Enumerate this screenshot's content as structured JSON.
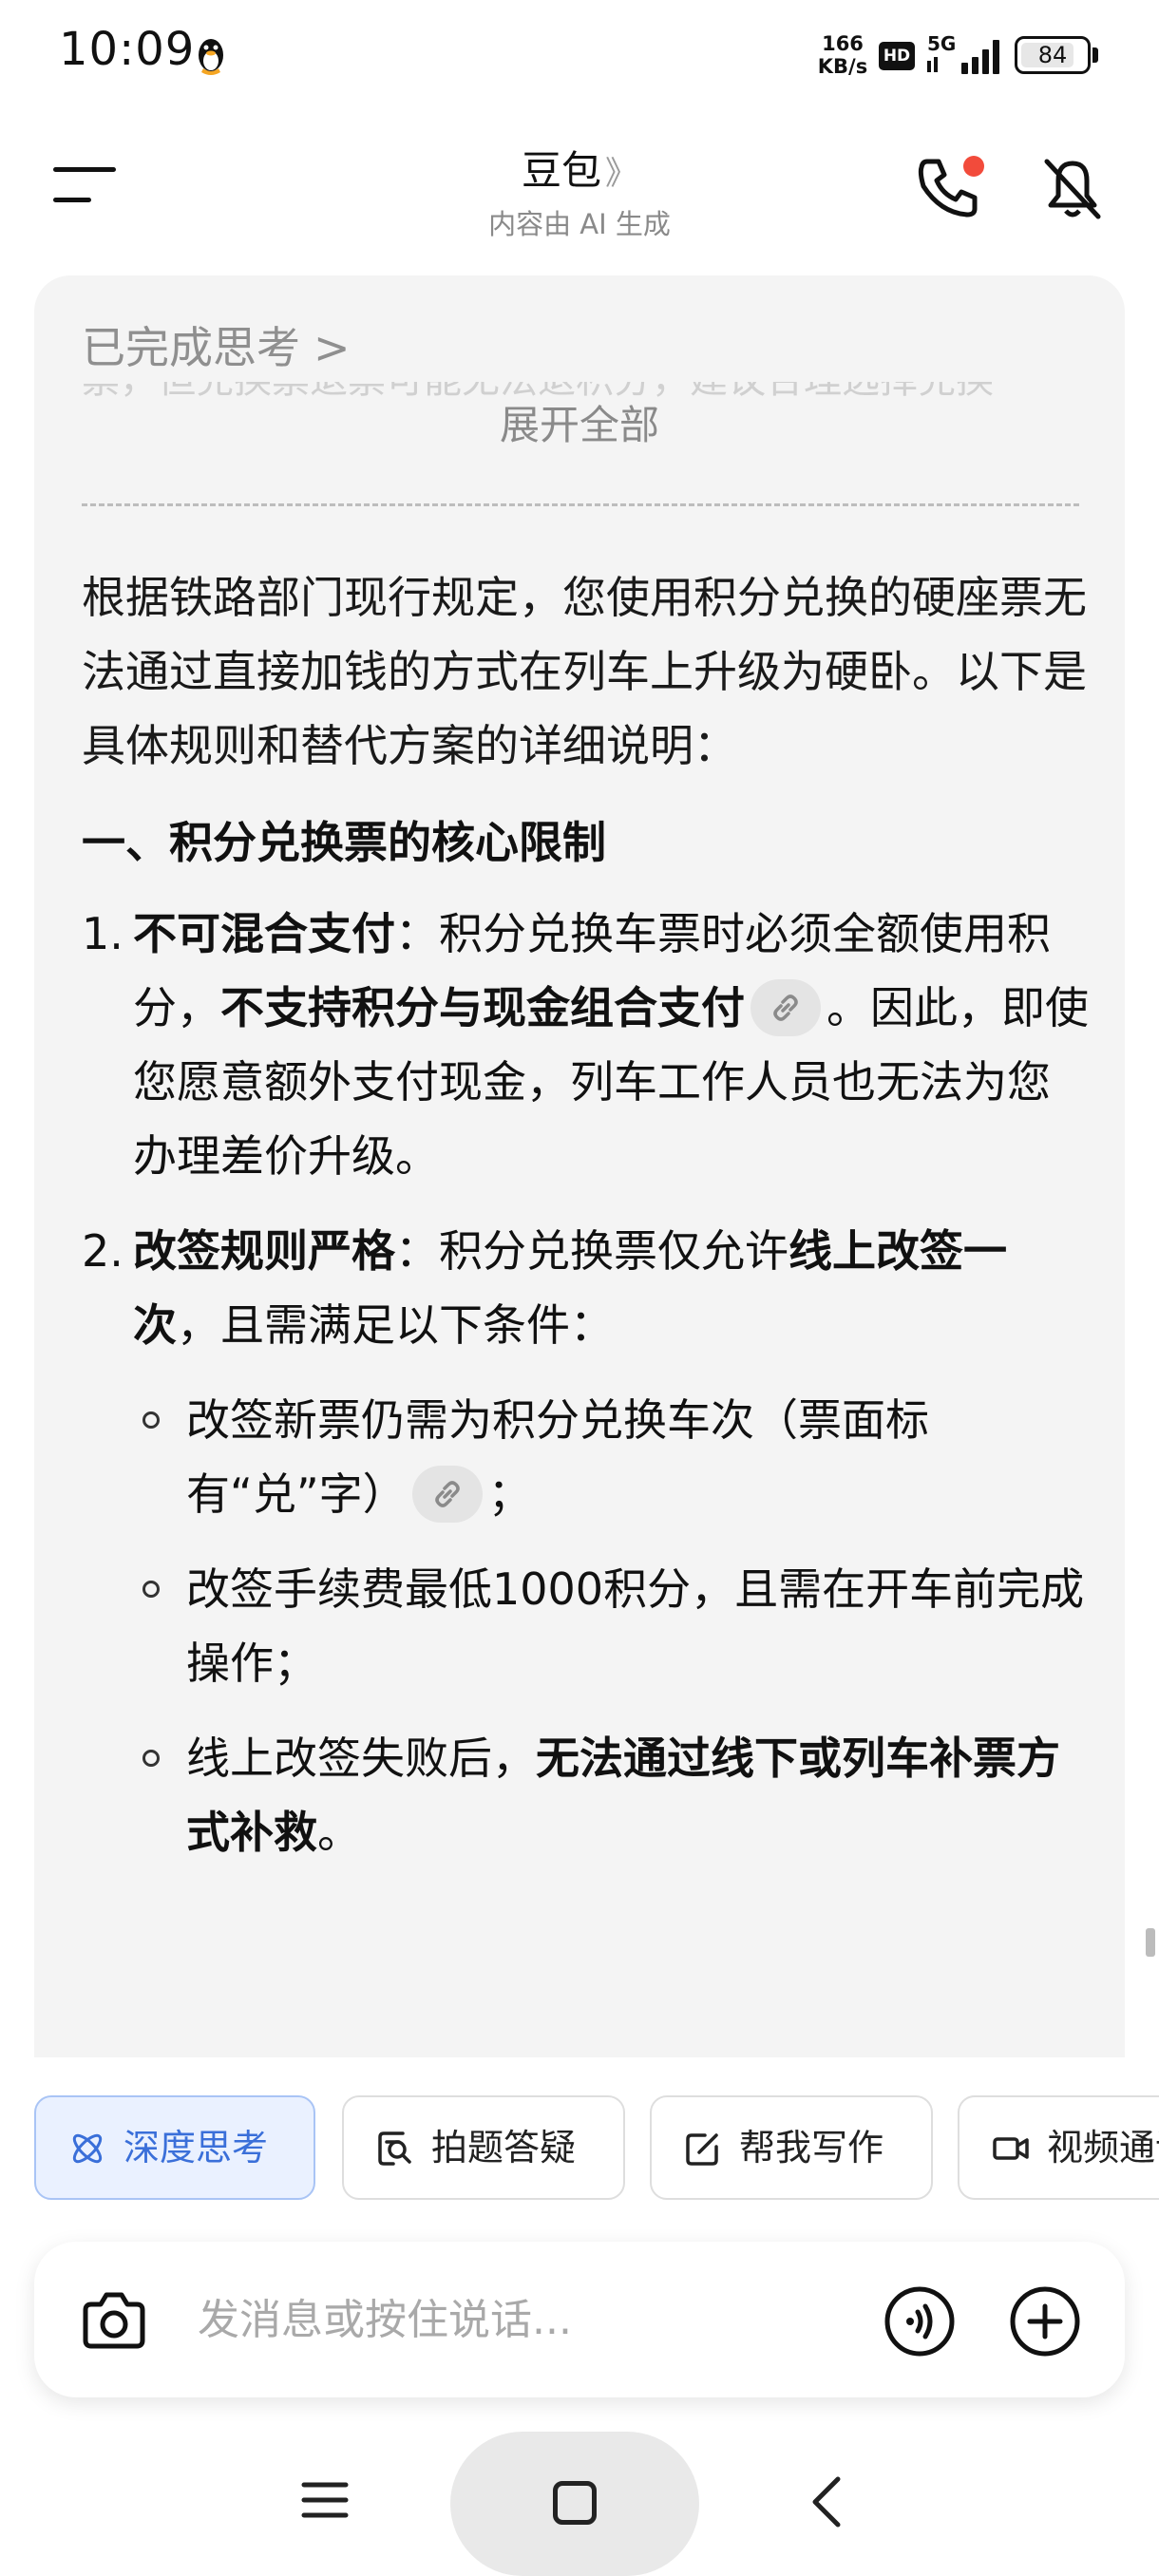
{
  "status_bar": {
    "time": "10:09",
    "net_speed_value": "166",
    "net_speed_unit": "KB/s",
    "hd_label": "HD",
    "network_label": "5G",
    "battery_percent": "84",
    "battery_level": 0.84
  },
  "header": {
    "title": "豆包",
    "title_chevron": "》",
    "subtitle": "内容由 AI 生成"
  },
  "message": {
    "thinking_label": "已完成思考",
    "thinking_preview": "票，但兑换票退票可能无法退积分，建议合理选择兑换",
    "expand_label": "展开全部",
    "intro": "根据铁路部门现行规定，您使用积分兑换的硬座票无法通过直接加钱的方式在列车上升级为硬卧。以下是具体规则和替代方案的详细说明：",
    "section_title": "一、积分兑换票的核心限制",
    "items": [
      {
        "num": "1.",
        "bold_lead": "不可混合支付",
        "text_a": "：积分兑换车票时必须全额使用积分，",
        "bold_mid": "不支持积分与现金组合支付",
        "text_b": "。因此，即使您愿意额外支付现金，列车工作人员也无法为您办理差价升级。"
      },
      {
        "num": "2.",
        "bold_lead": "改签规则严格",
        "text_a": "：积分兑换票仅允许",
        "bold_mid": "线上改签一次",
        "text_b": "，且需满足以下条件：",
        "bullets": [
          {
            "text_a": "改签新票仍需为积分兑换车次（票面标有“兑”字）",
            "text_b": "；"
          },
          {
            "text_a": "改签手续费最低1000积分，且需在开车前完成操作；"
          },
          {
            "text_a": "线上改签失败后，",
            "bold": "无法通过线下或列车补票方式补救",
            "text_b": "。"
          }
        ]
      }
    ]
  },
  "shortcuts": [
    {
      "label": "深度思考",
      "icon": "atom-icon",
      "active": true
    },
    {
      "label": "拍题答疑",
      "icon": "photo-search-icon",
      "active": false
    },
    {
      "label": "帮我写作",
      "icon": "edit-icon",
      "active": false
    },
    {
      "label": "视频通话",
      "icon": "video-icon",
      "active": false
    }
  ],
  "input": {
    "placeholder": "发消息或按住说话..."
  },
  "colors": {
    "accent": "#3a6fd9",
    "bubble_bg": "#f4f4f4",
    "call_badge": "#f24b3b"
  }
}
